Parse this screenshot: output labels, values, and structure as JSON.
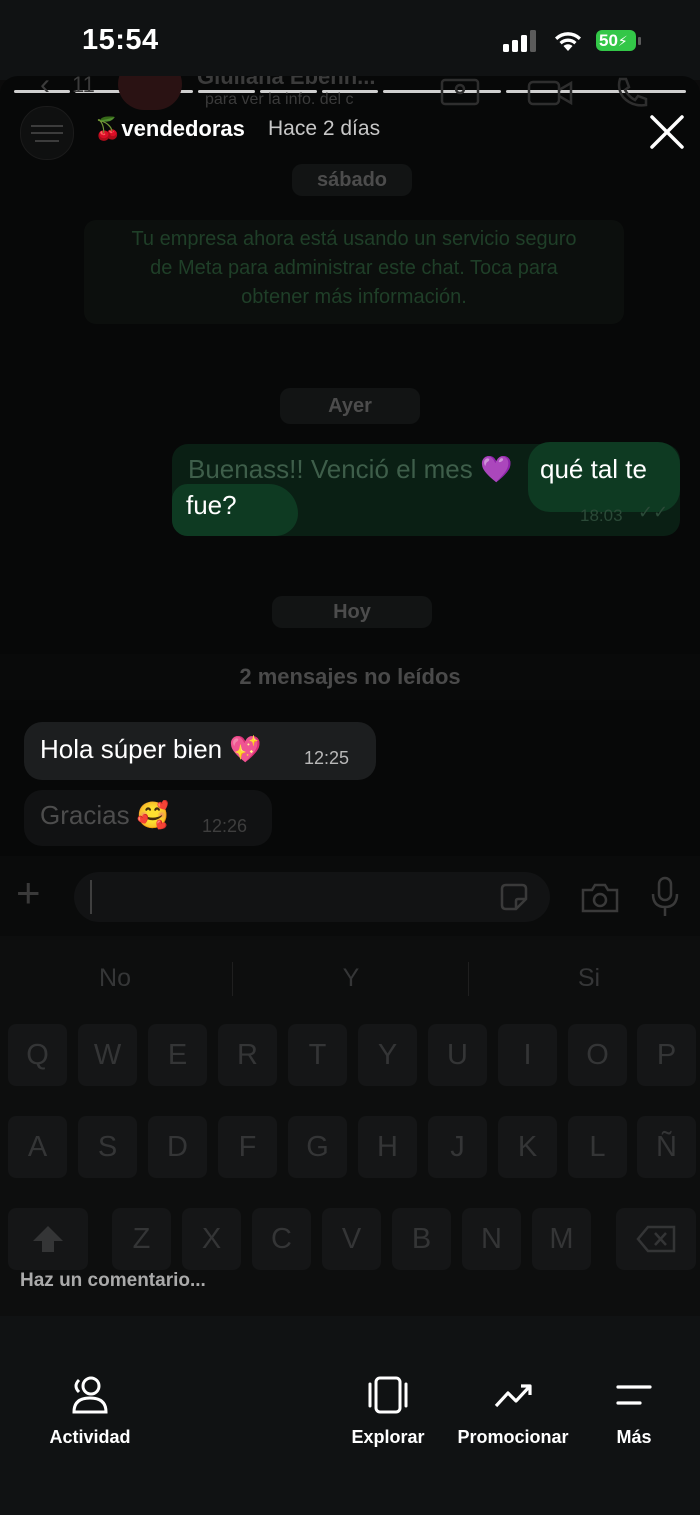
{
  "status_bar": {
    "time": "15:54",
    "battery": "50"
  },
  "story_header": {
    "account_emoji": "🍒",
    "account_name": "vendedoras",
    "posted_ago": "Hace 2 días",
    "close_icon": "close-icon"
  },
  "background_chat": {
    "contact_name": "Giuliana Ebenh...",
    "contact_subtitle": "para ver la info. del c",
    "back_count": "11",
    "day_saturday": "sábado",
    "security_notice": [
      "Tu empresa ahora está usando un servicio seguro",
      "de Meta para administrar este chat. Toca para",
      "obtener más información."
    ],
    "day_yesterday": "Ayer",
    "outgoing_message_part1": "Buenass!! Venció el mes 💜",
    "outgoing_message_part2_a": "qué tal te",
    "outgoing_message_part2_b": "fue?",
    "outgoing_time": "18:03",
    "day_today": "Hoy",
    "unread_divider": "2 mensajes no leídos",
    "incoming_1_text": "Hola súper bien 💖",
    "incoming_1_time": "12:25",
    "incoming_2_text": "Gracias 🥰",
    "incoming_2_time": "12:26"
  },
  "keyboard": {
    "suggestions": [
      "No",
      "Y",
      "Si"
    ],
    "row1": [
      "Q",
      "W",
      "E",
      "R",
      "T",
      "Y",
      "U",
      "I",
      "O",
      "P"
    ],
    "row2": [
      "A",
      "S",
      "D",
      "F",
      "G",
      "H",
      "J",
      "K",
      "L",
      "Ñ"
    ],
    "row3": [
      "Z",
      "X",
      "C",
      "V",
      "B",
      "N",
      "M"
    ]
  },
  "comment_placeholder": "Haz un comentario...",
  "bottom_nav": {
    "activity": "Actividad",
    "explore": "Explorar",
    "promote": "Promocionar",
    "more": "Más"
  }
}
